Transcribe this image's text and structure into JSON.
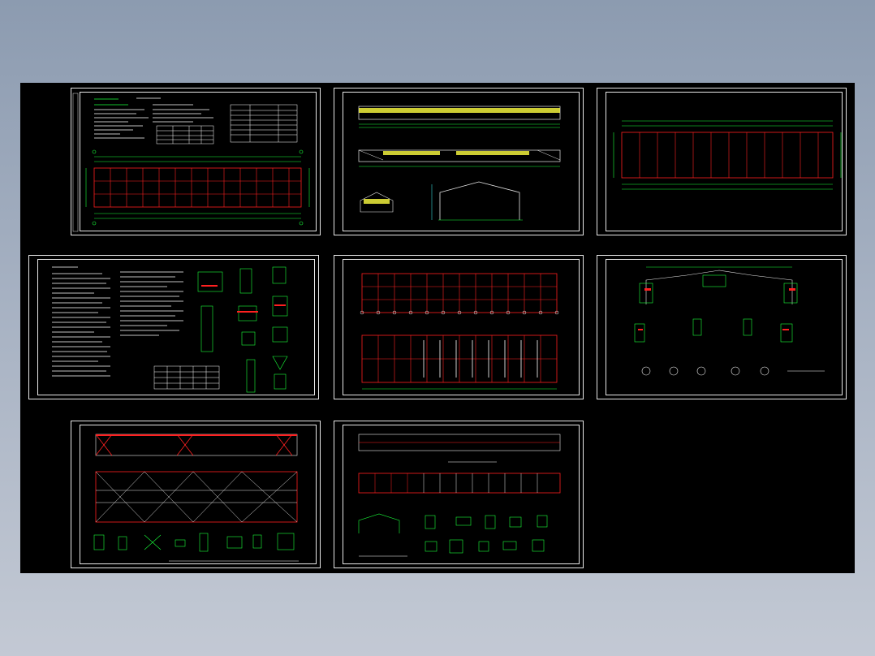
{
  "viewer": {
    "background": [
      "#8c9bb0",
      "#c3c9d4"
    ],
    "canvas_color": "#000000"
  },
  "colors": {
    "frame": "#e8e8e8",
    "grid_red": "#ff2020",
    "dim_green": "#19ff3a",
    "text_white": "#ffffff",
    "hatch_yellow": "#ffff40",
    "cyan": "#40ffff"
  },
  "sheets": [
    {
      "id": "sheet-1",
      "kind": "notes-and-plan"
    },
    {
      "id": "sheet-2",
      "kind": "elevations-and-section"
    },
    {
      "id": "sheet-3",
      "kind": "plan-grid"
    },
    {
      "id": "sheet-4",
      "kind": "notes-and-details"
    },
    {
      "id": "sheet-5",
      "kind": "double-plan"
    },
    {
      "id": "sheet-6",
      "kind": "frame-details"
    },
    {
      "id": "sheet-7",
      "kind": "bracing-plan"
    },
    {
      "id": "sheet-8",
      "kind": "purlin-plan"
    }
  ]
}
